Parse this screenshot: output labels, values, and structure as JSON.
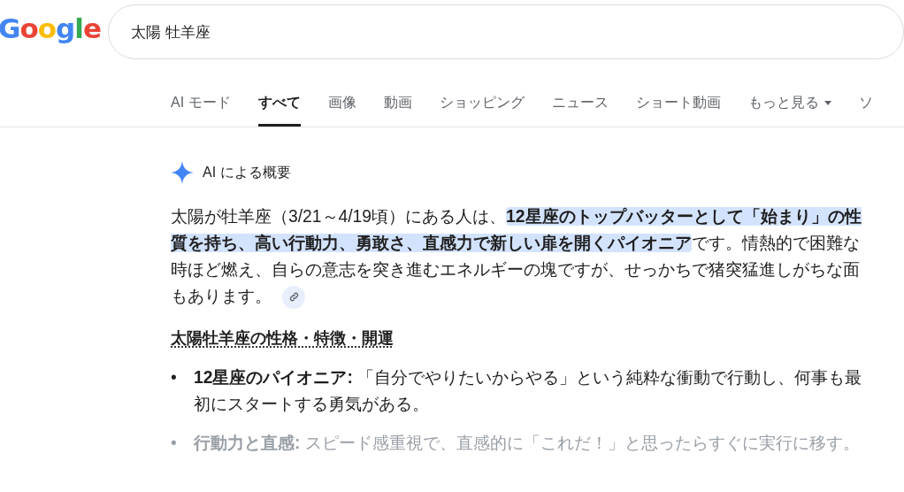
{
  "logo": "Google",
  "search": {
    "value": "太陽 牡羊座"
  },
  "tabs": [
    {
      "label": "AI モード",
      "selected": false
    },
    {
      "label": "すべて",
      "selected": true
    },
    {
      "label": "画像",
      "selected": false
    },
    {
      "label": "動画",
      "selected": false
    },
    {
      "label": "ショッピング",
      "selected": false
    },
    {
      "label": "ニュース",
      "selected": false
    },
    {
      "label": "ショート動画",
      "selected": false
    },
    {
      "label": "もっと見る",
      "selected": false,
      "kind": "menu"
    },
    {
      "label": "ソ",
      "selected": false
    }
  ],
  "overview": {
    "title": "AI による概要",
    "paragraph": [
      {
        "text": "太陽が牡羊座（3/21～4/19頃）にある人は、",
        "highlighted": false
      },
      {
        "text": "12星座のトップバッターとして「始まり」の性質を持ち、高い行動力、勇敢さ、直感力で新しい扉を開くパイオニア",
        "highlighted": true
      },
      {
        "text": "です。情熱的で困難な時ほど燃え、自らの意志を突き進むエネルギーの塊ですが、せっかちで猪突猛進しがちな面もあります。",
        "highlighted": false
      }
    ],
    "heading": "太陽牡羊座の性格・特徴・開運",
    "bullets": [
      {
        "marker": "•",
        "term": "12星座のパイオニア:",
        "text": "「自分でやりたいからやる」という純粋な衝動で行動し、何事も最初にスタートする勇気がある。",
        "faded": false
      },
      {
        "marker": "•",
        "term": "行動力と直感:",
        "text": "スピード感重視で、直感的に「これだ！」と思ったらすぐに実行に移す。",
        "faded": true
      }
    ]
  }
}
